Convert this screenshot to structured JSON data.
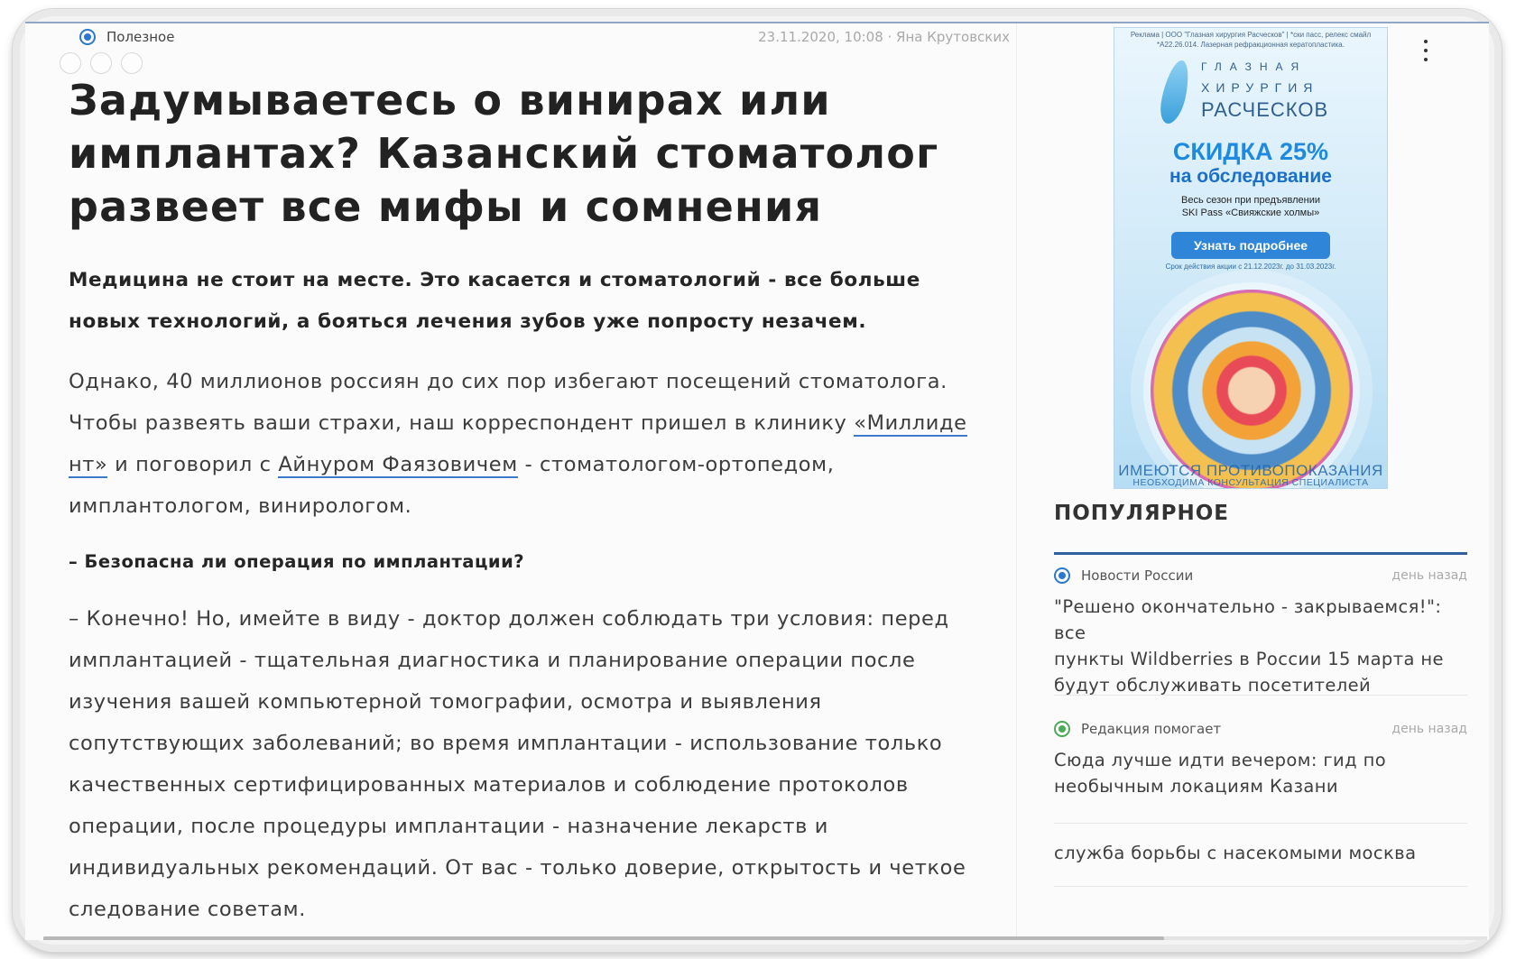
{
  "article": {
    "category": "Полезное",
    "date_author": "23.11.2020, 10:08 · Яна Крутовских",
    "title_lines": [
      "Задумываетесь о винирах или",
      "имплантах? Казанский стоматолог",
      "развеет все мифы и сомнения"
    ],
    "lead_lines": [
      "Медицина не стоит на месте. Это касается и стоматологий - все больше",
      "новых технологий, а бояться лечения зубов уже попросту незачем."
    ],
    "p1": {
      "line1": "Однако, 40 миллионов россиян до сих пор избегают посещений стоматолога.",
      "line2_before": "Чтобы развеять ваши страхи, наш корреспондент пришел в клинику ",
      "link1_part1": "«Миллиде",
      "link1_part2": "нт»",
      "line3_mid": " и поговорил с ",
      "link2": "Айнуром Фаязовичем",
      "line3_after": " - стоматологом-ортопедом,",
      "line4": "имплантологом, винирологом."
    },
    "question": "– Безопасна ли операция по имплантации?",
    "answer_lines": [
      "– Конечно! Но, имейте в виду - доктор должен соблюдать три условия: перед",
      "имплантацией - тщательная диагностика и планирование операции после",
      "изучения вашей компьютерной томографии, осмотра и выявления",
      "сопутствующих заболеваний; во время имплантации - использование только",
      "качественных сертифицированных материалов и соблюдение протоколов",
      "операции, после процедуры имплантации - назначение лекарств и",
      "индивидуальных рекомендаций. От вас - только доверие, открытость и четкое",
      "следование советам."
    ]
  },
  "ad": {
    "disclaimer": "Реклама | ООО \"Глазная хирургия Расческов\" | *ски пасс, релекс смайл *А22.26.014. Лазерная рефракционная кератопластика.",
    "logo_line1": "ГЛАЗНАЯ",
    "logo_line2": "ХИРУРГИЯ",
    "logo_line3": "РАСЧЕСКОВ",
    "discount": "СКИДКА 25%",
    "sub": "на обследование",
    "small1": "Весь сезон при предъявлении",
    "small2": "SKI Pass «Свияжские холмы»",
    "button": "Узнать подробнее",
    "term": "Срок действия акции с 21.12.2023г. до 31.03.2023г.",
    "warning1": "ИМЕЮТСЯ ПРОТИВОПОКАЗАНИЯ",
    "warning2": "НЕОБХОДИМА КОНСУЛЬТАЦИЯ СПЕЦИАЛИСТА"
  },
  "popular": {
    "title": "ПОПУЛЯРНОЕ",
    "items": [
      {
        "category": "Новости России",
        "time": "день назад",
        "lines": [
          "\"Решено окончательно - закрываемся!\": все",
          "пункты Wildberries в России 15 марта не",
          "будут обслуживать посетителей"
        ],
        "color": "#2c78cf"
      },
      {
        "category": "Редакция помогает",
        "time": "день назад",
        "lines": [
          "Сюда лучше идти вечером: гид по",
          "необычным локациям Казани"
        ],
        "color": "#4cab59"
      }
    ],
    "extra_link": "служба борьбы с насекомыми москва"
  },
  "scrollbar": {
    "position_fraction": 0.78
  }
}
